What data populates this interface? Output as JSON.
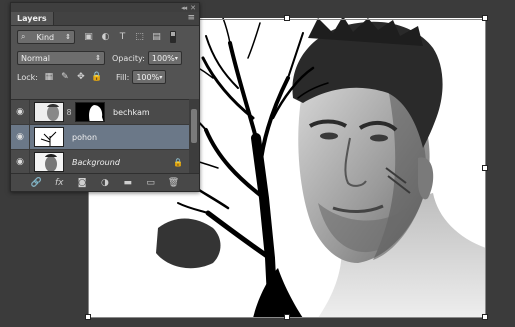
{
  "panel": {
    "title": "Layers",
    "collapse_glyph": "◂◂",
    "close_glyph": "✕",
    "menu_glyph": "≡"
  },
  "filter": {
    "kind_label": "Kind",
    "icons": [
      "image-filter-icon",
      "adjustment-filter-icon",
      "type-filter-icon",
      "shape-filter-icon",
      "smart-object-filter-icon"
    ],
    "glyphs": [
      "▣",
      "◐",
      "T",
      "⬚",
      "▤"
    ]
  },
  "blend": {
    "mode": "Normal",
    "opacity_label": "Opacity:",
    "opacity_value": "100%"
  },
  "lock": {
    "lock_label": "Lock:",
    "fill_label": "Fill:",
    "fill_value": "100%",
    "glyphs": [
      "▦",
      "✎",
      "✥",
      "🔒"
    ]
  },
  "layers": [
    {
      "name": "bechkam",
      "visible": true,
      "has_mask": true,
      "selected": false,
      "locked": false
    },
    {
      "name": "pohon",
      "visible": true,
      "has_mask": false,
      "selected": true,
      "locked": false
    },
    {
      "name": "Background",
      "visible": true,
      "has_mask": false,
      "selected": false,
      "locked": true
    }
  ],
  "bottom_glyphs": [
    "🔗",
    "fx",
    "◙",
    "◑",
    "▬",
    "▭",
    "🗑"
  ],
  "eye_glyph": "◉",
  "link_glyph": "8",
  "lock_glyph": "🔒",
  "accent_selected": "#6b7888"
}
